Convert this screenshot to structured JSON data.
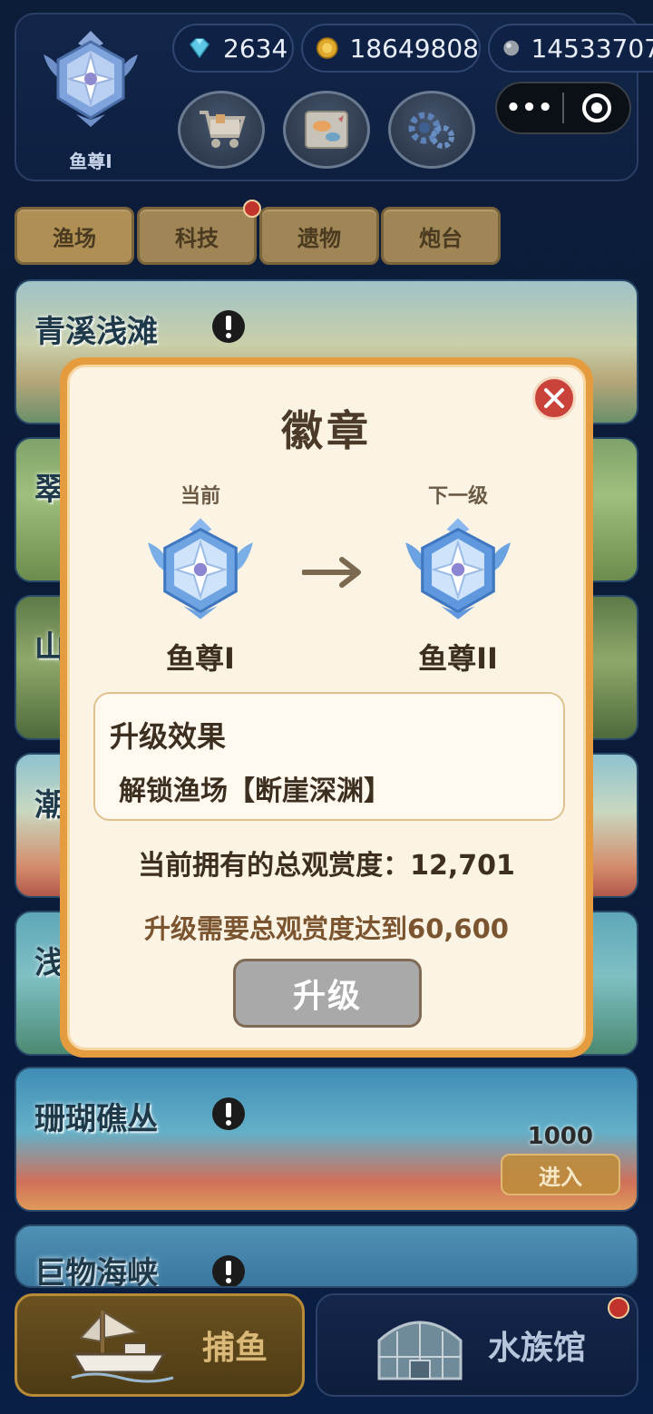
{
  "header": {
    "rank_label": "鱼尊I",
    "currencies": {
      "gems": "2634",
      "gold": "18649808",
      "pearls": "14533707"
    },
    "capsule_more": "•••"
  },
  "tabs": [
    {
      "label": "渔场"
    },
    {
      "label": "科技"
    },
    {
      "label": "遗物"
    },
    {
      "label": "炮台"
    }
  ],
  "grounds": [
    {
      "name": "青溪浅滩"
    },
    {
      "name": "翠"
    },
    {
      "name": "山"
    },
    {
      "name": "潮"
    },
    {
      "name": "浅"
    },
    {
      "name": "珊瑚礁丛",
      "cost": "1000",
      "enter_label": "进入"
    },
    {
      "name": "巨物海峡"
    }
  ],
  "modal": {
    "title": "徽章",
    "current_label": "当前",
    "next_label": "下一级",
    "current_rank": "鱼尊I",
    "next_rank": "鱼尊II",
    "effect_title": "升级效果",
    "effect_text": "解锁渔场【断崖深渊】",
    "owned_text": "当前拥有的总观赏度：12,701",
    "need_text": "升级需要总观赏度达到60,600",
    "upgrade_label": "升级"
  },
  "bottom_nav": {
    "fishing_label": "捕鱼",
    "aquarium_label": "水族馆"
  },
  "colors": {
    "modal_border": "#e49c3e",
    "modal_bg": "#fbf3e4",
    "close_red": "#c9433b",
    "upgrade_disabled": "#a9a9a9",
    "notification_red": "#c0342b"
  }
}
